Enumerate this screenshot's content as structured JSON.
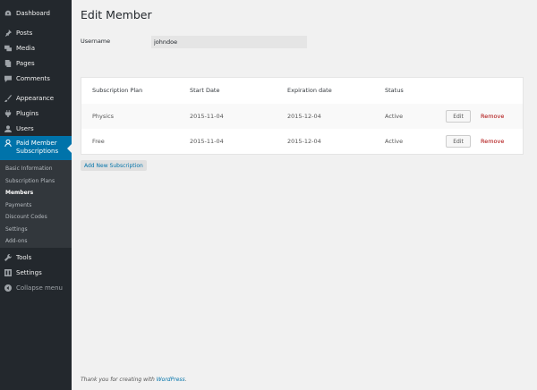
{
  "sidebar": {
    "items": [
      {
        "label": "Dashboard",
        "icon": "dashboard-icon"
      },
      {
        "label": "Posts",
        "icon": "pin-icon"
      },
      {
        "label": "Media",
        "icon": "media-icon"
      },
      {
        "label": "Pages",
        "icon": "pages-icon"
      },
      {
        "label": "Comments",
        "icon": "comment-icon"
      },
      {
        "label": "Appearance",
        "icon": "brush-icon"
      },
      {
        "label": "Plugins",
        "icon": "plugin-icon"
      },
      {
        "label": "Users",
        "icon": "users-icon"
      },
      {
        "label": "Paid Member Subscriptions",
        "icon": "member-icon"
      },
      {
        "label": "Tools",
        "icon": "wrench-icon"
      },
      {
        "label": "Settings",
        "icon": "settings-icon"
      },
      {
        "label": "Collapse menu",
        "icon": "collapse-icon"
      }
    ],
    "submenu": [
      "Basic Information",
      "Subscription Plans",
      "Members",
      "Payments",
      "Discount Codes",
      "Settings",
      "Add-ons"
    ],
    "active_sub": "Members",
    "colors": {
      "bg": "#23282d",
      "current": "#0073aa",
      "submenu_bg": "#32373c"
    }
  },
  "main": {
    "title": "Edit Member",
    "username_label": "Username",
    "username_value": "johndoe",
    "table": {
      "headers": [
        "Subscription Plan",
        "Start Date",
        "Expiration date",
        "Status"
      ],
      "rows": [
        {
          "plan": "Physics",
          "start": "2015-11-04",
          "expiration": "2015-12-04",
          "status": "Active",
          "edit": "Edit",
          "remove": "Remove"
        },
        {
          "plan": "Free",
          "start": "2015-11-04",
          "expiration": "2015-12-04",
          "status": "Active",
          "edit": "Edit",
          "remove": "Remove"
        }
      ]
    },
    "add_button": "Add New Subscription",
    "footer_text": "Thank you for creating with ",
    "footer_link": "WordPress",
    "footer_end": "."
  }
}
